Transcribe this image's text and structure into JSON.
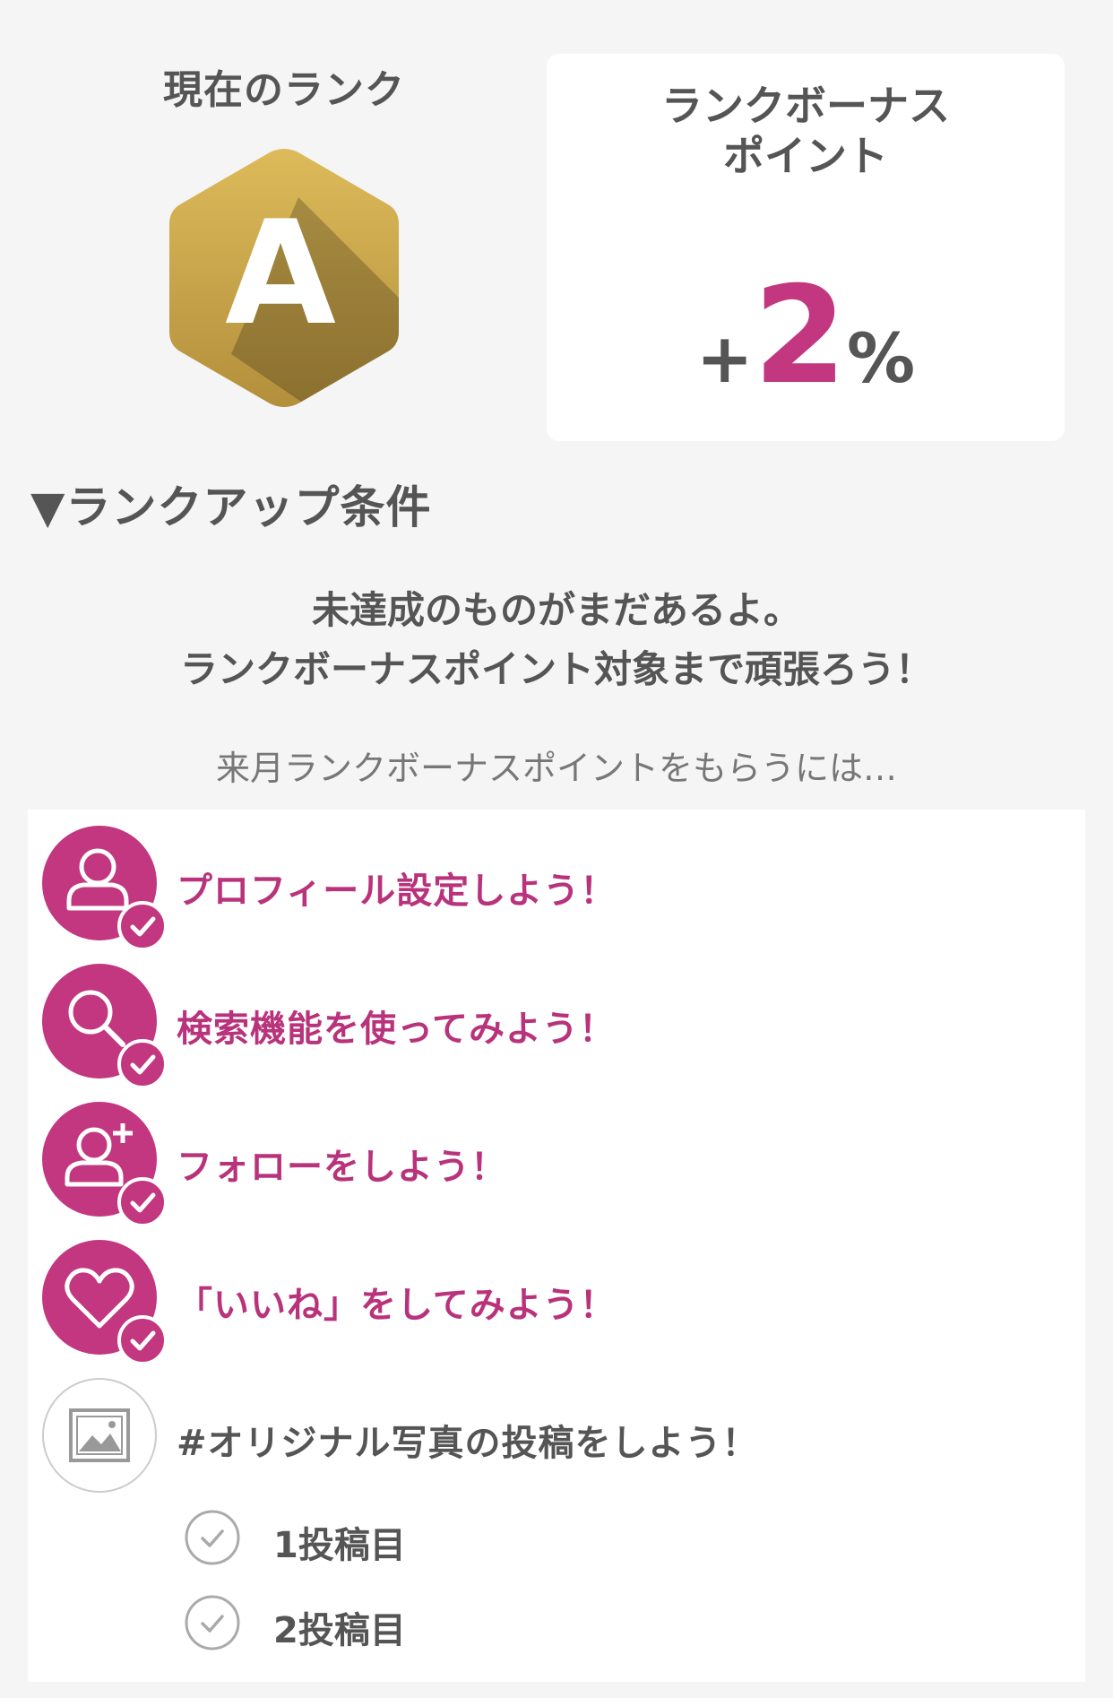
{
  "rank": {
    "title": "現在のランク",
    "letter": "A"
  },
  "bonus": {
    "title_line1": "ランクボーナス",
    "title_line2": "ポイント",
    "plus": "+",
    "value": "2",
    "unit": "%"
  },
  "section": {
    "heading": "▼ランクアップ条件"
  },
  "message": {
    "line1": "未達成のものがまだあるよ。",
    "line2": "ランクボーナスポイント対象まで頑張ろう！"
  },
  "subtext": "来月ランクボーナスポイントをもらうには…",
  "conditions": [
    {
      "label": "プロフィール設定しよう！",
      "icon": "person-icon",
      "completed": true
    },
    {
      "label": "検索機能を使ってみよう！",
      "icon": "search-icon",
      "completed": true
    },
    {
      "label": "フォローをしよう！",
      "icon": "add-person-icon",
      "completed": true
    },
    {
      "label": "「いいね」をしてみよう！",
      "icon": "heart-icon",
      "completed": true
    },
    {
      "label": "#オリジナル写真の投稿をしよう！",
      "icon": "image-icon",
      "completed": false
    }
  ],
  "post_steps": [
    {
      "label": "1投稿目",
      "completed": false
    },
    {
      "label": "2投稿目",
      "completed": false
    }
  ],
  "colors": {
    "accent": "#c2377f",
    "gold": "#c9a548",
    "text": "#555555",
    "background": "#f5f5f5"
  }
}
